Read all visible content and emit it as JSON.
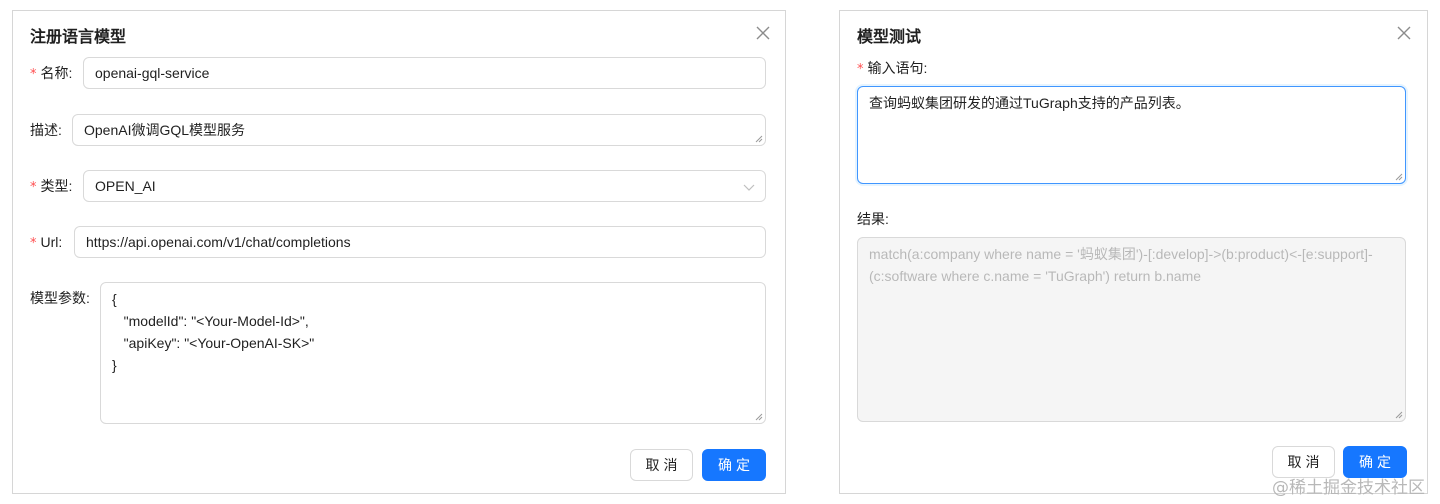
{
  "register_modal": {
    "title": "注册语言模型",
    "name_field": {
      "label": "名称",
      "value": "openai-gql-service",
      "required": true
    },
    "description_field": {
      "label": "描述",
      "value": "OpenAI微调GQL模型服务"
    },
    "type_field": {
      "label": "类型",
      "value": "OPEN_AI",
      "required": true
    },
    "url_field": {
      "label": "Url",
      "value": "https://api.openai.com/v1/chat/completions",
      "required": true
    },
    "params_field": {
      "label": "模型参数",
      "lines": [
        "{",
        "   \"modelId\": \"<Your-Model-Id>\",",
        "   \"apiKey\": \"<Your-OpenAI-SK>\"",
        "}"
      ]
    },
    "cancel_label": "取消",
    "ok_label": "确定"
  },
  "test_modal": {
    "title": "模型测试",
    "input_field": {
      "label": "输入语句:",
      "value": "查询蚂蚁集团研发的通过TuGraph支持的产品列表。",
      "required": true
    },
    "result_field": {
      "label": "结果:",
      "value": "match(a:company where name = '蚂蚁集团')-[:develop]->(b:product)<-[e:support]-(c:software where c.name = 'TuGraph') return b.name"
    },
    "cancel_label": "取消",
    "ok_label": "确定"
  },
  "watermark": "@稀土掘金技术社区",
  "colors": {
    "primary": "#1677ff",
    "required_mark": "#ff4d4f",
    "border": "#d9d9d9",
    "disabled_bg": "#f5f5f5"
  },
  "icons": {
    "close": "close-icon",
    "select_arrow": "chevron-down-icon",
    "resize": "resize-grip-icon"
  }
}
